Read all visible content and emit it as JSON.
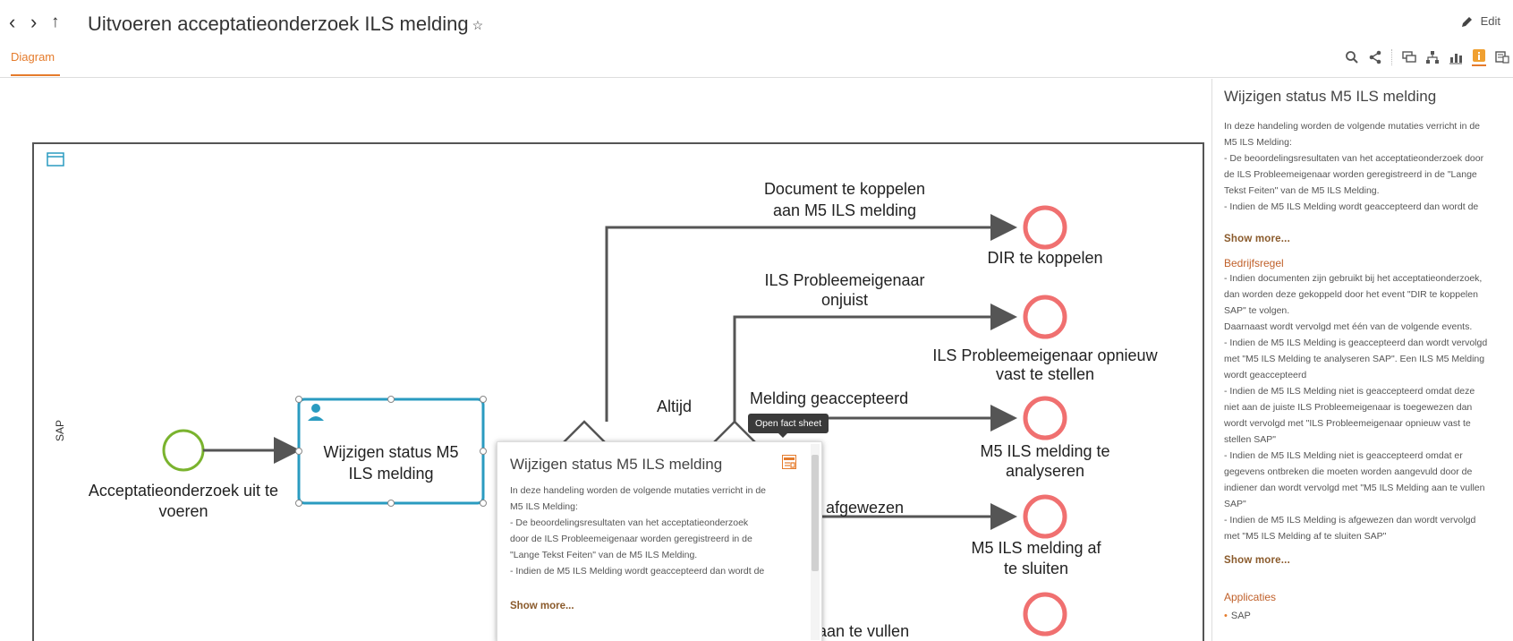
{
  "header": {
    "title": "Uitvoeren acceptatieonderzoek ILS melding",
    "star": "☆",
    "edit_label": "Edit"
  },
  "tabs": [
    {
      "label": "Diagram"
    }
  ],
  "diagram": {
    "pool_label": "SAP",
    "start_event_label_1": "Acceptatieonderzoek uit te",
    "start_event_label_2": "voeren",
    "task_label_1": "Wijzigen status M5",
    "task_label_2": "ILS melding",
    "flow_1_1": "Document te koppelen",
    "flow_1_2": "aan M5 ILS melding",
    "end_1": "DIR te koppelen",
    "flow_2_1": "ILS Probleemeigenaar",
    "flow_2_2": "onjuist",
    "end_2_1": "ILS Probleemeigenaar opnieuw",
    "end_2_2": "vast te stellen",
    "flow_altijd": "Altijd",
    "flow_3": "Melding geaccepteerd",
    "end_3_1": "M5 ILS melding te",
    "end_3_2": "analyseren",
    "flow_4": "afgewezen",
    "end_4_1": "M5 ILS melding af",
    "end_4_2": "te sluiten",
    "flow_5": "aan te vullen"
  },
  "tooltip": {
    "text": "Open fact sheet"
  },
  "popup": {
    "title": "Wijzigen status M5 ILS melding",
    "text": "In deze handeling worden de volgende mutaties verricht in de\nM5 ILS Melding:\n- De beoordelingsresultaten van het acceptatieonderzoek\ndoor de ILS Probleemeigenaar worden geregistreerd in de\n\"Lange Tekst Feiten\" van de M5 ILS Melding.\n- Indien de M5 ILS Melding wordt geaccepteerd dan wordt de",
    "show_more": "Show more..."
  },
  "panel": {
    "title": "Wijzigen status M5 ILS melding",
    "description": "In deze handeling worden de volgende mutaties verricht in de\nM5 ILS Melding:\n- De beoordelingsresultaten van het acceptatieonderzoek door\nde ILS Probleemeigenaar worden geregistreerd in de \"Lange\nTekst Feiten\" van de M5 ILS Melding.\n- Indien de M5 ILS Melding wordt geaccepteerd dan wordt de",
    "show_more_1": "Show more...",
    "rule_heading": "Bedrijfsregel",
    "rule_text": "- Indien documenten zijn gebruikt bij het acceptatieonderzoek,\ndan worden deze gekoppeld door het event \"DIR te koppelen\nSAP\" te volgen.\nDaarnaast wordt vervolgd met één van de volgende events.\n- Indien de M5 ILS Melding is geaccepteerd dan wordt vervolgd\nmet \"M5 ILS Melding te analyseren SAP\". Een ILS M5 Melding\nwordt geaccepteerd\n- Indien de M5 ILS Melding niet is geaccepteerd omdat deze\nniet aan de juiste ILS Probleemeigenaar is toegewezen dan\nwordt vervolgd met \"ILS Probleemeigenaar opnieuw vast te\nstellen SAP\"\n- Indien de M5 ILS Melding niet is geaccepteerd omdat er\ngegevens ontbreken die moeten worden aangevuld door de\nindiener dan wordt vervolgd met \"M5 ILS Melding aan te vullen\nSAP\"\n- Indien de M5 ILS Melding is afgewezen dan wordt vervolgd\nmet \"M5 ILS Melding af te sluiten SAP\"",
    "show_more_2": "Show more...",
    "apps_heading": "Applicaties",
    "apps": [
      "SAP"
    ]
  },
  "colors": {
    "accent": "#e57b2b",
    "task_border": "#2a9bc0",
    "start_event": "#7ab32e",
    "end_event": "#f07070"
  }
}
